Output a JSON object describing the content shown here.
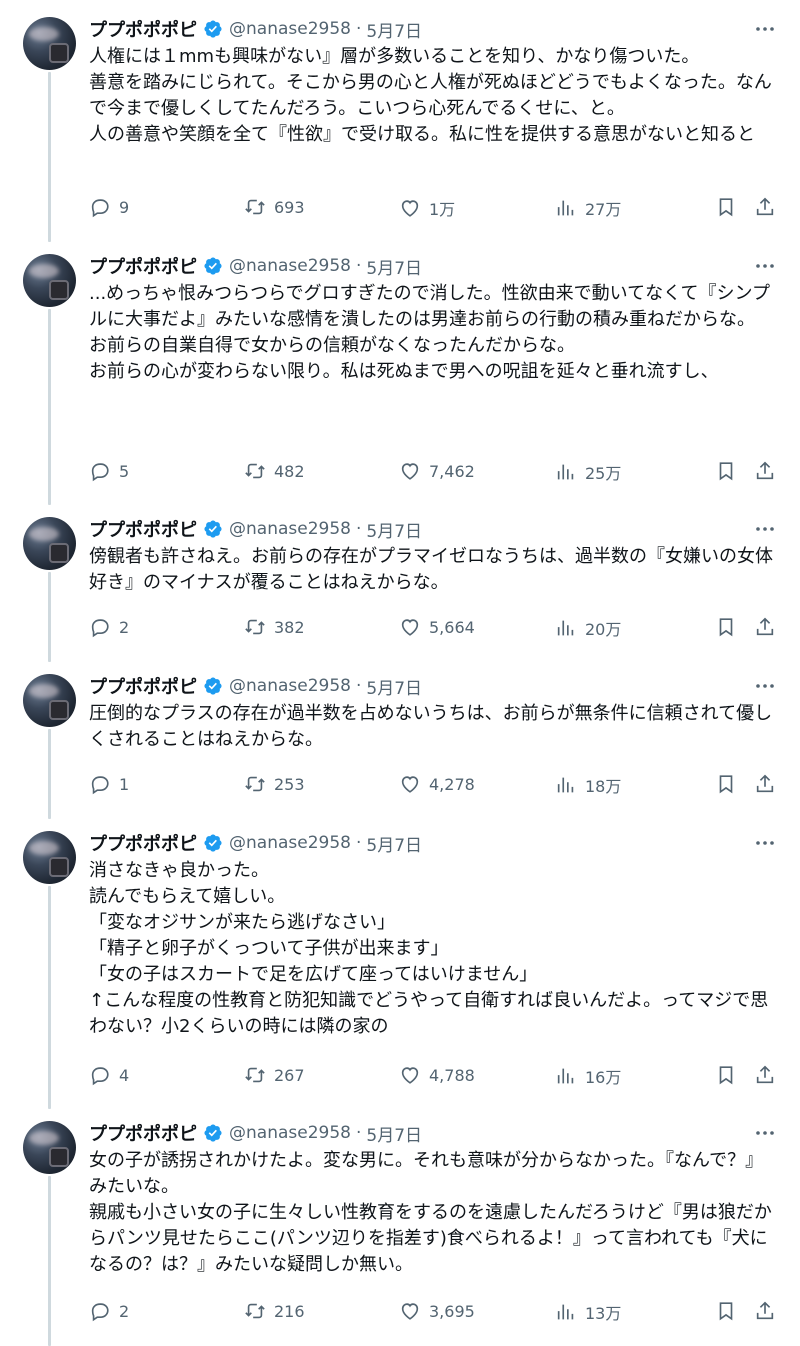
{
  "tweets": [
    {
      "name": "ププポポポピ",
      "handle": "@nanase2958",
      "date": "5月7日",
      "text": "人権には１mmも興味がない』層が多数いることを知り、かなり傷ついた。\n善意を踏みにじられて。そこから男の心と人権が死ぬほどどうでもよくなった。なんで今まで優しくしてたんだろう。こいつら心死んでるくせに、と。\n人の善意や笑顔を全て『性欲』で受け取る。私に性を提供する意思がないと知ると",
      "replies": "9",
      "retweets": "693",
      "likes": "1万",
      "views": "27万"
    },
    {
      "name": "ププポポポピ",
      "handle": "@nanase2958",
      "date": "5月7日",
      "text": "...めっちゃ恨みつらつらでグロすぎたので消した。性欲由来で動いてなくて『シンプルに大事だよ』みたいな感情を潰したのは男達お前らの行動の積み重ねだからな。\nお前らの自業自得で女からの信頼がなくなったんだからな。\nお前らの心が変わらない限り。私は死ぬまで男への呪詛を延々と垂れ流すし、",
      "replies": "5",
      "retweets": "482",
      "likes": "7,462",
      "views": "25万"
    },
    {
      "name": "ププポポポピ",
      "handle": "@nanase2958",
      "date": "5月7日",
      "text": "傍観者も許さねえ。お前らの存在がプラマイゼロなうちは、過半数の『女嫌いの女体好き』のマイナスが覆ることはねえからな。",
      "replies": "2",
      "retweets": "382",
      "likes": "5,664",
      "views": "20万"
    },
    {
      "name": "ププポポポピ",
      "handle": "@nanase2958",
      "date": "5月7日",
      "text": "圧倒的なプラスの存在が過半数を占めないうちは、お前らが無条件に信頼されて優しくされることはねえからな。",
      "replies": "1",
      "retweets": "253",
      "likes": "4,278",
      "views": "18万"
    },
    {
      "name": "ププポポポピ",
      "handle": "@nanase2958",
      "date": "5月7日",
      "text": "消さなきゃ良かった。\n読んでもらえて嬉しい。\n「変なオジサンが来たら逃げなさい」\n「精子と卵子がくっついて子供が出来ます」\n「女の子はスカートで足を広げて座ってはいけません」\n↑こんな程度の性教育と防犯知識でどうやって自衛すれば良いんだよ。ってマジで思わない？小2くらいの時には隣の家の",
      "replies": "4",
      "retweets": "267",
      "likes": "4,788",
      "views": "16万"
    },
    {
      "name": "ププポポポピ",
      "handle": "@nanase2958",
      "date": "5月7日",
      "text": "女の子が誘拐されかけたよ。変な男に。それも意味が分からなかった。『なんで？』みたいな。\n親戚も小さい女の子に生々しい性教育をするのを遠慮したんだろうけど『男は狼だからパンツ見せたらここ(パンツ辺りを指差す)食べられるよ！』って言われても『犬になるの？は？』みたいな疑問しか無い。",
      "replies": "2",
      "retweets": "216",
      "likes": "3,695",
      "views": "13万"
    }
  ],
  "icons": {
    "verified": "verified-badge-icon",
    "more": "more-dots-icon",
    "reply": "reply-icon",
    "retweet": "retweet-icon",
    "like": "heart-icon",
    "views": "views-chart-icon",
    "bookmark": "bookmark-icon",
    "share": "share-icon"
  },
  "colors": {
    "text": "#0f1419",
    "muted": "#536471",
    "verified": "#1d9bf0",
    "thread_line": "#cfd9de"
  }
}
